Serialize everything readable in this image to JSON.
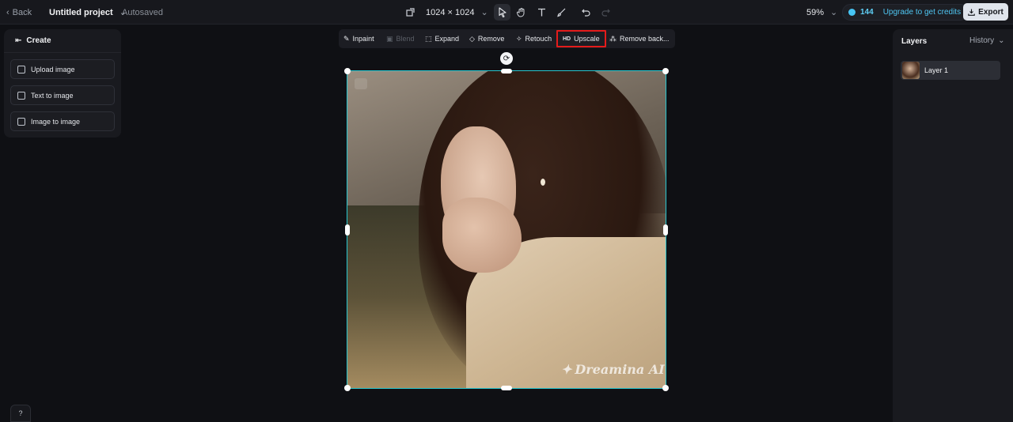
{
  "topbar": {
    "back_label": "Back",
    "project_name": "Untitled project",
    "autosave_status": "Autosaved",
    "canvas_size": "1024 × 1024",
    "zoom": "59%",
    "credits": "144",
    "upgrade_label": "Upgrade to get credits",
    "export_label": "Export",
    "tools": [
      "select-icon",
      "hand-icon",
      "text-icon",
      "brush-icon",
      "undo-icon",
      "redo-icon"
    ]
  },
  "left_panel": {
    "title": "Create",
    "buttons": [
      "Upload image",
      "Text to image",
      "Image to image"
    ]
  },
  "edit_toolbar": {
    "items": [
      {
        "label": "Inpaint",
        "icon": "inpaint-icon",
        "enabled": true
      },
      {
        "label": "Blend",
        "icon": "blend-icon",
        "enabled": false
      },
      {
        "label": "Expand",
        "icon": "expand-icon",
        "enabled": true
      },
      {
        "label": "Remove",
        "icon": "eraser-icon",
        "enabled": true
      },
      {
        "label": "Retouch",
        "icon": "sparkle-icon",
        "enabled": true
      },
      {
        "label": "Upscale",
        "icon": "hd-icon",
        "icon_text": "HD",
        "enabled": true,
        "highlighted": true
      },
      {
        "label": "Remove back...",
        "icon": "remove-bg-icon",
        "enabled": true
      }
    ]
  },
  "canvas": {
    "watermark": "Dreamina AI"
  },
  "right_panel": {
    "layers_title": "Layers",
    "history_label": "History",
    "layers": [
      "Layer 1"
    ]
  },
  "colors": {
    "accent": "#28c6cf",
    "highlight": "#e41b1b",
    "credit_blue": "#4fc6f2"
  }
}
